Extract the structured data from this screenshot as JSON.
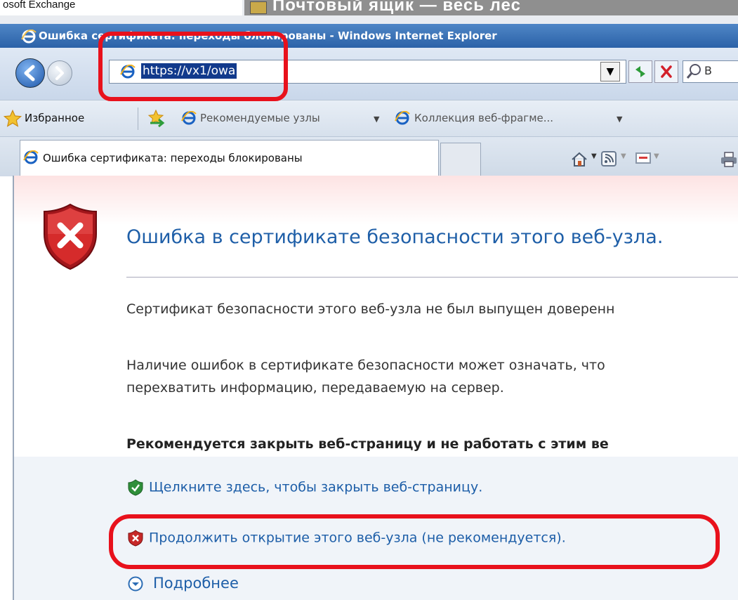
{
  "background_window": {
    "left_text": "osoft Exchange",
    "right_title": "Почтовый ящик — весь лес"
  },
  "browser": {
    "window_title": "Ошибка сертификата: переходы блокированы - Windows Internet Explorer",
    "address": {
      "url": "https://vx1/owa"
    },
    "search": {
      "placeholder_visible": "B"
    },
    "favorites_bar": {
      "favorites_label": "Избранное",
      "items": [
        {
          "label": "Рекомендуемые узлы"
        },
        {
          "label": "Коллекция веб-фрагме..."
        }
      ]
    },
    "tab": {
      "title": "Ошибка сертификата: переходы блокированы"
    }
  },
  "page": {
    "heading": "Ошибка в сертификате безопасности этого веб-узла.",
    "paragraph1": "Сертификат безопасности этого веб-узла не был выпущен доверенн",
    "paragraph2_line1": "Наличие ошибок в сертификате безопасности может означать, что",
    "paragraph2_line2": "перехватить информацию, передаваемую на сервер.",
    "recommendation": "Рекомендуется закрыть веб-страницу и не работать с этим ве",
    "close_link": "Щелкните здесь, чтобы закрыть веб-страницу.",
    "continue_link": "Продолжить открытие этого веб-узла (не рекомендуется).",
    "more_info": "Подробнее"
  },
  "colors": {
    "link": "#1d5ea8",
    "annotation": "#e8111c",
    "heading": "#1f5fa8"
  }
}
